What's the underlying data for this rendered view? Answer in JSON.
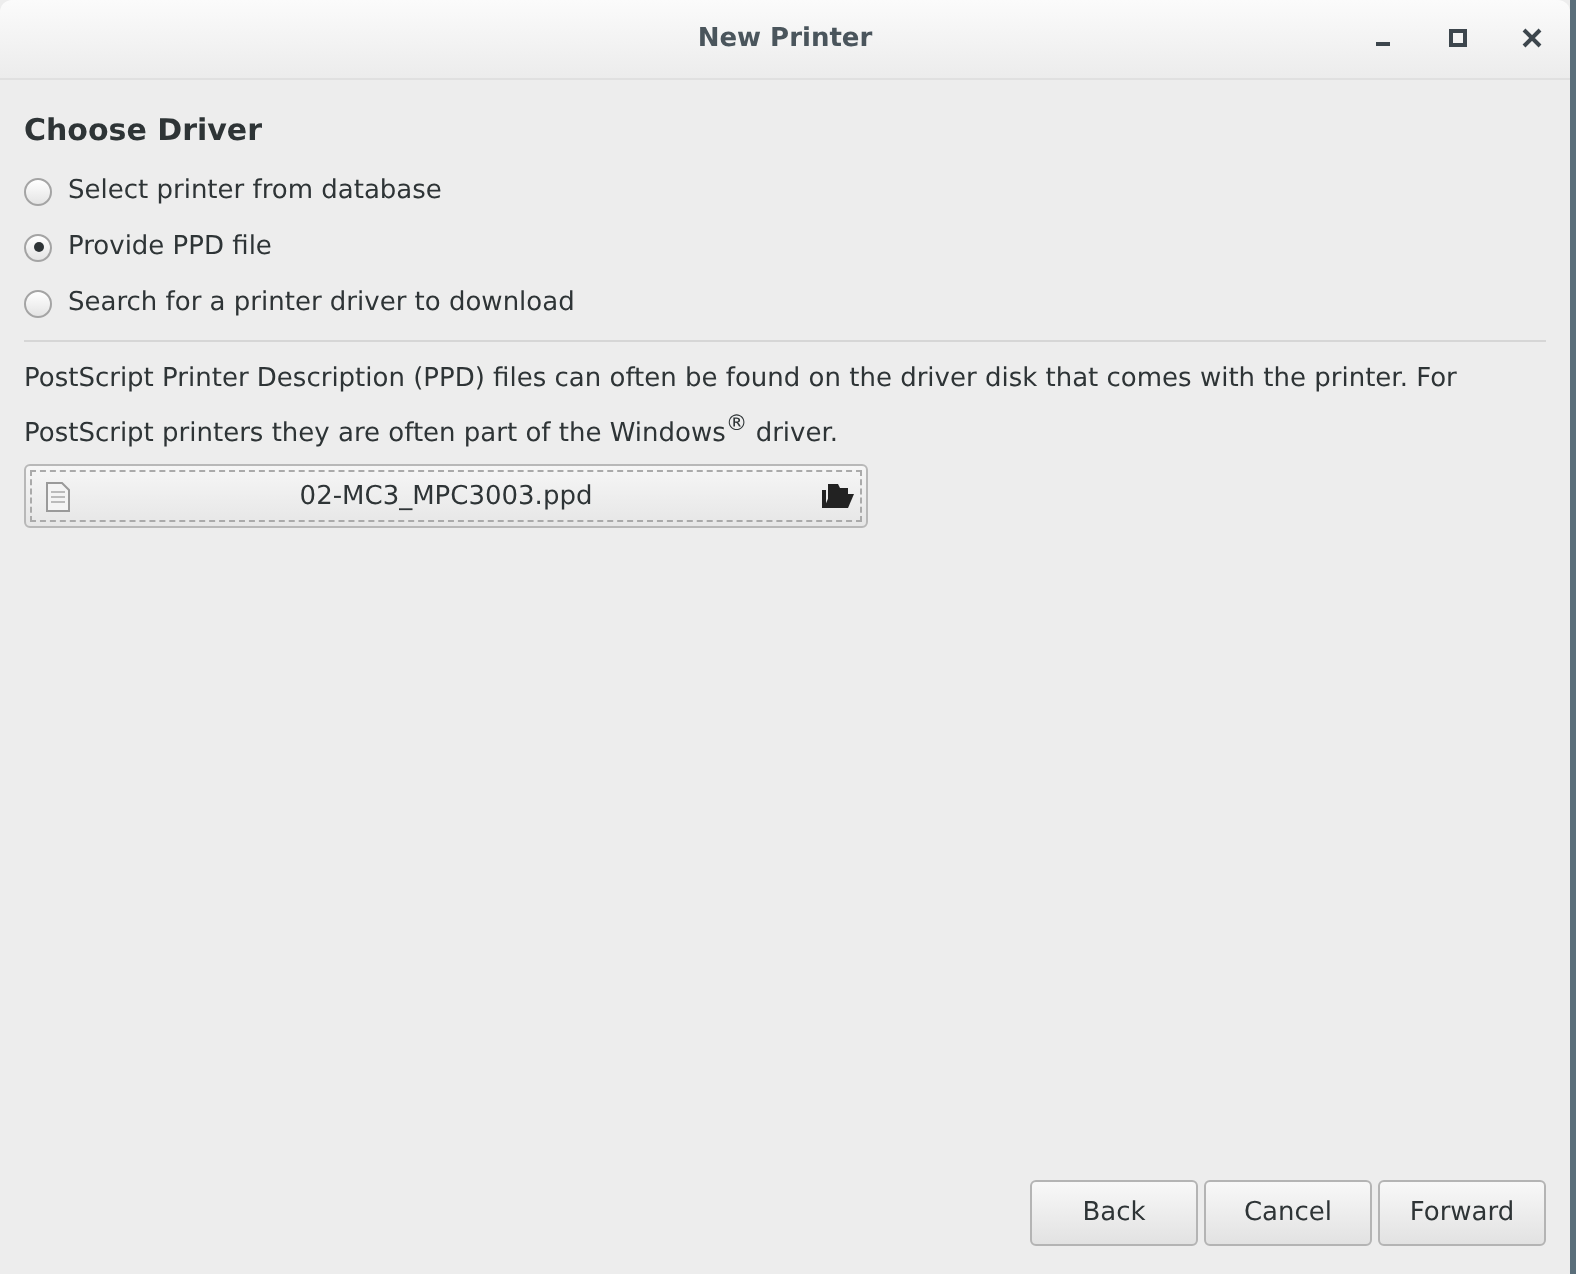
{
  "window": {
    "title": "New Printer"
  },
  "heading": "Choose Driver",
  "options": [
    {
      "label": "Select printer from database",
      "selected": false
    },
    {
      "label": "Provide PPD file",
      "selected": true
    },
    {
      "label": "Search for a printer driver to download",
      "selected": false
    }
  ],
  "description": "PostScript Printer Description (PPD) files can often be found on the driver disk that comes with the printer. For PostScript printers they are often part of the Windows$^{®}$ driver.",
  "file_chooser": {
    "value": "02-MC3_MPC3003.ppd"
  },
  "buttons": [
    "Back",
    "Cancel",
    "Forward"
  ]
}
